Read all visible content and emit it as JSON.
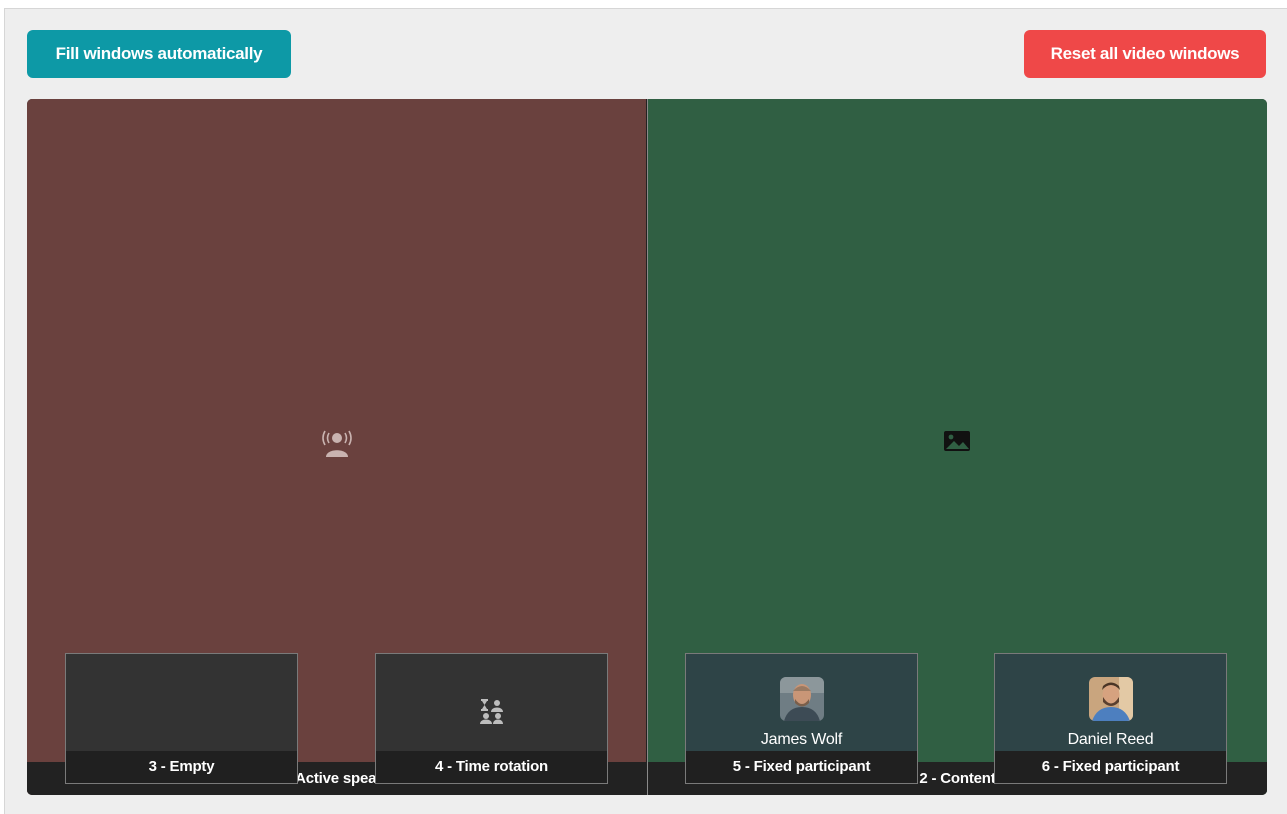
{
  "toolbar": {
    "fill_label": "Fill windows automatically",
    "reset_label": "Reset all video windows"
  },
  "windows": {
    "main": [
      {
        "label": "1 - Active speaker",
        "icon": "active-speaker-icon",
        "color": "#6a413e"
      },
      {
        "label": "2 - Content",
        "icon": "image-icon",
        "color": "#305f43"
      }
    ],
    "tiles": [
      {
        "label": "3 - Empty",
        "icon": "",
        "participant": ""
      },
      {
        "label": "4 - Time rotation",
        "icon": "time-rotation-icon",
        "participant": ""
      },
      {
        "label": "5 - Fixed participant",
        "icon": "avatar",
        "participant": "James Wolf"
      },
      {
        "label": "6 - Fixed participant",
        "icon": "avatar",
        "participant": "Daniel Reed"
      }
    ]
  },
  "colors": {
    "fill_button": "#0d99a6",
    "reset_button": "#ef4848",
    "panel_bg": "#eeeeee",
    "label_bar": "#222222"
  }
}
